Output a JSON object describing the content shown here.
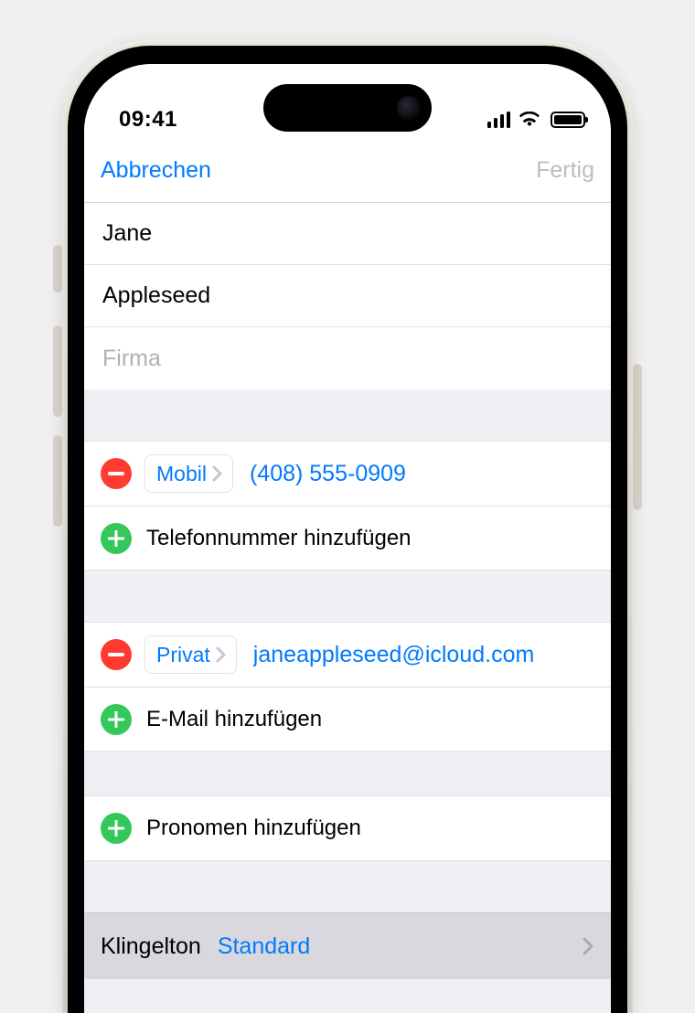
{
  "status": {
    "time": "09:41"
  },
  "nav": {
    "cancel": "Abbrechen",
    "done": "Fertig"
  },
  "contact": {
    "first_name": "Jane",
    "last_name": "Appleseed",
    "company": "",
    "company_placeholder": "Firma"
  },
  "phone": {
    "type_label": "Mobil",
    "value": "(408) 555-0909",
    "add_label": "Telefonnummer hinzufügen"
  },
  "email": {
    "type_label": "Privat",
    "value": "janeappleseed@icloud.com",
    "add_label": "E-Mail hinzufügen"
  },
  "pronouns": {
    "add_label": "Pronomen hinzufügen"
  },
  "ringtone": {
    "key": "Klingelton",
    "value": "Standard"
  },
  "colors": {
    "link": "#007aff",
    "delete": "#ff3b30",
    "add": "#34c759"
  }
}
